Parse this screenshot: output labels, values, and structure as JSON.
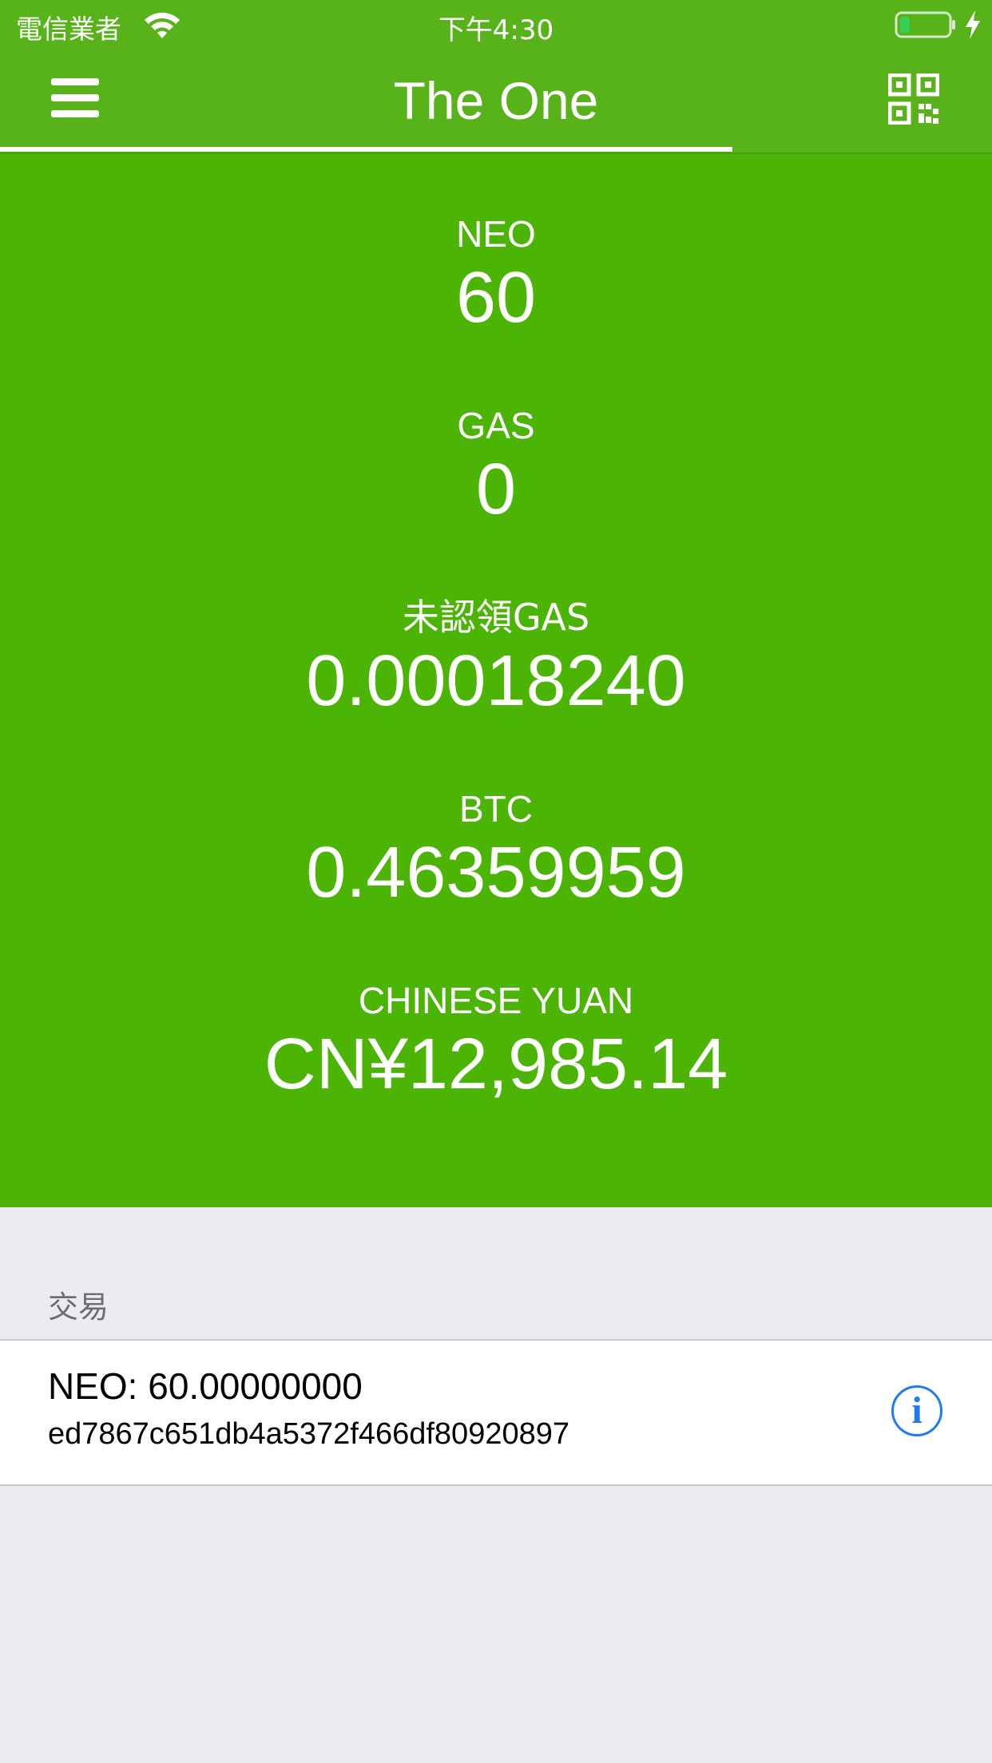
{
  "status_bar": {
    "carrier": "電信業者",
    "time": "下午4:30"
  },
  "nav": {
    "title": "The One",
    "menu_icon": "hamburger-menu-icon",
    "qr_icon": "qr-code-icon"
  },
  "balances": [
    {
      "label": "NEO",
      "value": "60"
    },
    {
      "label": "GAS",
      "value": "0"
    },
    {
      "label": "未認領GAS",
      "value": "0.00018240"
    },
    {
      "label": "BTC",
      "value": "0.46359959"
    },
    {
      "label": "CHINESE YUAN",
      "value": "CN¥12,985.14"
    }
  ],
  "transactions": {
    "header": "交易",
    "items": [
      {
        "amount": "NEO: 60.00000000",
        "hash": "ed7867c651db4a5372f466df80920897",
        "info_label": "i"
      }
    ]
  },
  "colors": {
    "nav_green": "#58b31b",
    "balance_green": "#4bb405",
    "background": "#ebebf1",
    "info_blue": "#1f7af5"
  }
}
